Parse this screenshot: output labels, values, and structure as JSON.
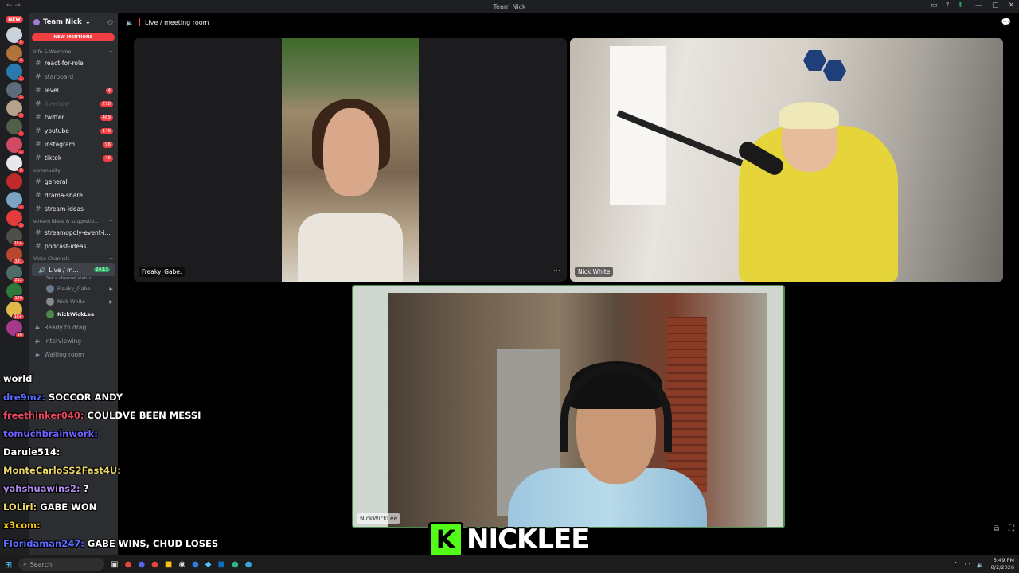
{
  "window": {
    "title": "Team Nick",
    "nav": "← →"
  },
  "rail": {
    "new_label": "NEW",
    "servers": [
      {
        "color": "#c9d1d9",
        "badge": "2"
      },
      {
        "color": "#b1733a",
        "badge": "3"
      },
      {
        "color": "#2a7ab0",
        "badge": "1"
      },
      {
        "color": "#5d6b7a",
        "badge": "1"
      },
      {
        "color": "#b6a28a",
        "badge": "1"
      },
      {
        "color": "#4f5f4a",
        "badge": "1"
      },
      {
        "color": "#d04a64",
        "badge": "1"
      },
      {
        "color": "#e8e8ea",
        "badge": "2"
      },
      {
        "color": "#c12a2a",
        "badge": ""
      },
      {
        "color": "#7aa4c4",
        "badge": "1"
      },
      {
        "color": "#e23b3b",
        "badge": "1"
      },
      {
        "color": "#4f4e4a",
        "badge": "1k+"
      },
      {
        "color": "#b9472e",
        "badge": "341"
      },
      {
        "color": "#506a66",
        "badge": "212"
      },
      {
        "color": "#2f7a3a",
        "badge": "149"
      },
      {
        "color": "#e1b84a",
        "badge": "1k+"
      },
      {
        "color": "#a63a8a",
        "badge": "16"
      }
    ]
  },
  "sidebar": {
    "server_name": "Team Nick",
    "new_mentions": "NEW MENTIONS",
    "categories": [
      {
        "label": "Info & Welcome",
        "channels": [
          {
            "name": "react-for-role",
            "count": "",
            "state": "unread"
          },
          {
            "name": "starboard",
            "count": "",
            "state": "read"
          },
          {
            "name": "level",
            "count": "4",
            "state": "unread"
          },
          {
            "name": "live-now",
            "count": "278",
            "state": "muted"
          },
          {
            "name": "twitter",
            "count": "489",
            "state": "unread"
          },
          {
            "name": "youtube",
            "count": "146",
            "state": "unread"
          },
          {
            "name": "instagram",
            "count": "96",
            "state": "unread"
          },
          {
            "name": "tiktok",
            "count": "46",
            "state": "unread"
          }
        ]
      },
      {
        "label": "community",
        "channels": [
          {
            "name": "general",
            "count": "",
            "state": "unread"
          },
          {
            "name": "drama-share",
            "count": "",
            "state": "unread"
          },
          {
            "name": "stream-ideas",
            "count": "",
            "state": "unread"
          }
        ]
      },
      {
        "label": "stream ideas & suggestio...",
        "channels": [
          {
            "name": "streamopoly-event-i...",
            "count": "",
            "state": "unread"
          },
          {
            "name": "podcast-ideas",
            "count": "",
            "state": "unread"
          }
        ]
      }
    ],
    "voice": {
      "label": "Voice Channels",
      "channel": "Live / m...",
      "timer": "24:13",
      "status": "Set a channel status",
      "users": [
        "Freaky_Gabe.",
        "Nick White",
        "NickWickLee"
      ],
      "other_channels": [
        "Ready to drag",
        "Interviewing",
        "Waiting room"
      ]
    }
  },
  "main": {
    "header": "Live / meeting room",
    "tiles": [
      {
        "name": "Freaky_Gabe."
      },
      {
        "name": "Nick White"
      },
      {
        "name": "NickWickLee"
      }
    ],
    "brand": {
      "k": "K",
      "name": "NICKLEE"
    }
  },
  "chat": [
    {
      "user": "world",
      "color": "#ffffff",
      "text": ""
    },
    {
      "user": "dre9mz:",
      "color": "#5b6cff",
      "text": "SOCCOR ANDY"
    },
    {
      "user": "freethinker040:",
      "color": "#e0475e",
      "text": "COULDVE BEEN MESSI"
    },
    {
      "user": "tomuchbrainwork:",
      "color": "#6f62ff",
      "text": ""
    },
    {
      "user": "Darule514:",
      "color": "#ffffff",
      "text": ""
    },
    {
      "user": "MonteCarloSS2Fast4U:",
      "color": "#e8d56a",
      "text": ""
    },
    {
      "user": "yahshuawins2:",
      "color": "#b38cf0",
      "text": "?"
    },
    {
      "user": "LOLirl:",
      "color": "#f2d96b",
      "text": "GABE WON"
    },
    {
      "user": "x3com:",
      "color": "#f5c518",
      "text": ""
    },
    {
      "user": "Floridaman247:",
      "color": "#5b6cff",
      "text": "GABE WINS, CHUD LOSES"
    }
  ],
  "taskbar": {
    "search_placeholder": "Search",
    "time": "5:49 PM",
    "date": "8/2/2026"
  }
}
